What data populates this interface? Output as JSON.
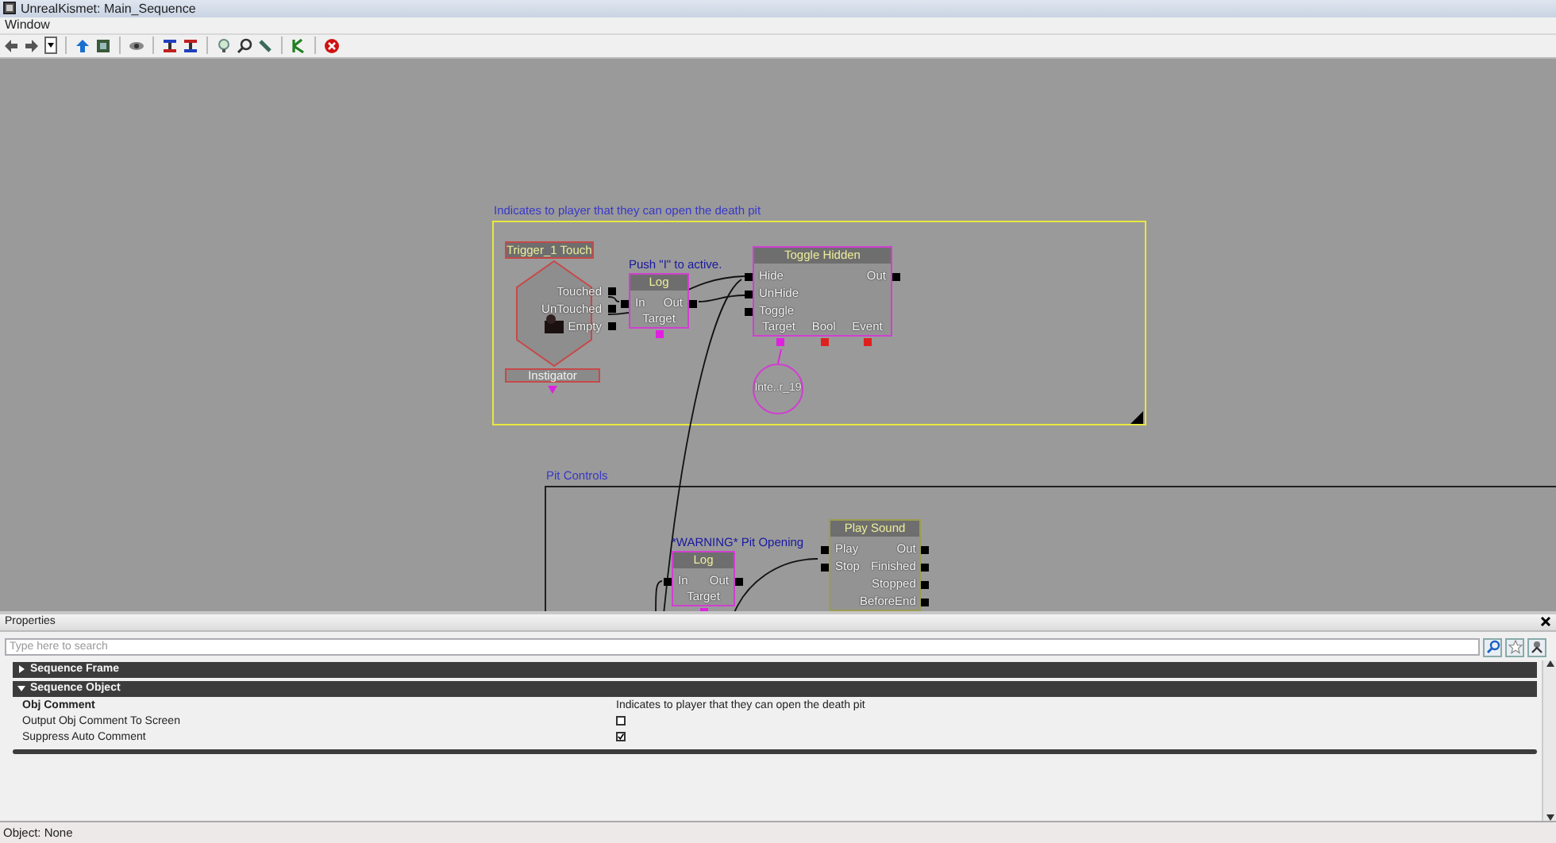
{
  "window": {
    "title": "UnrealKismet: Main_Sequence"
  },
  "menu": [
    "Window"
  ],
  "canvas": {
    "comment_frames": [
      {
        "label": "Indicates to player that they can open the death pit",
        "selected": true
      },
      {
        "label": "Pit Controls",
        "selected": false
      }
    ],
    "nodes": [
      {
        "kind": "event",
        "title": "Trigger_1 Touch",
        "color": "#c84848",
        "outputs": [
          "Touched",
          "UnTouched",
          "Empty"
        ],
        "variables": [
          {
            "name": "Instigator",
            "color": "#e020e0"
          }
        ]
      },
      {
        "kind": "action",
        "comment": "Push \"I\" to active.",
        "title": "Log",
        "color": "#d040d0",
        "inputs": [
          "In"
        ],
        "outputs": [
          "Out"
        ],
        "variables": [
          {
            "name": "Target",
            "color": "#e020e0"
          }
        ]
      },
      {
        "kind": "action",
        "title": "Toggle Hidden",
        "color": "#d040d0",
        "inputs": [
          "Hide",
          "UnHide",
          "Toggle"
        ],
        "outputs": [
          "Out"
        ],
        "variables": [
          {
            "name": "Target",
            "color": "#e020e0"
          },
          {
            "name": "Bool",
            "color": "#e02020"
          },
          {
            "name": "Event",
            "color": "#e02020"
          }
        ]
      },
      {
        "kind": "variable",
        "label": "Inte..r_19",
        "color": "#d040d0"
      },
      {
        "kind": "action",
        "comment": "*WARNING* Pit Opening",
        "title": "Log",
        "color": "#d040d0",
        "inputs": [
          "In"
        ],
        "outputs": [
          "Out"
        ],
        "variables": [
          {
            "name": "Target",
            "color": "#e020e0"
          }
        ]
      },
      {
        "kind": "action",
        "title": "Play Sound",
        "color": "#9c9c50",
        "inputs": [
          "Play",
          "Stop"
        ],
        "outputs": [
          "Out",
          "Finished",
          "Stopped",
          "BeforeEnd"
        ]
      }
    ]
  },
  "properties": {
    "title": "Properties",
    "search": {
      "placeholder": "Type here to search"
    },
    "categories": [
      {
        "label": "Sequence Frame",
        "expanded": false
      },
      {
        "label": "Sequence Object",
        "expanded": true,
        "rows": [
          {
            "kind": "text",
            "name": "Obj Comment",
            "modified": true,
            "value": "Indicates to player that they can open the death pit"
          },
          {
            "kind": "checkbox",
            "name": "Output Obj Comment To Screen",
            "modified": false,
            "checked": false
          },
          {
            "kind": "checkbox",
            "name": "Suppress Auto Comment",
            "modified": false,
            "checked": true
          }
        ]
      }
    ]
  },
  "status_bar": {
    "text": "Object: None"
  }
}
